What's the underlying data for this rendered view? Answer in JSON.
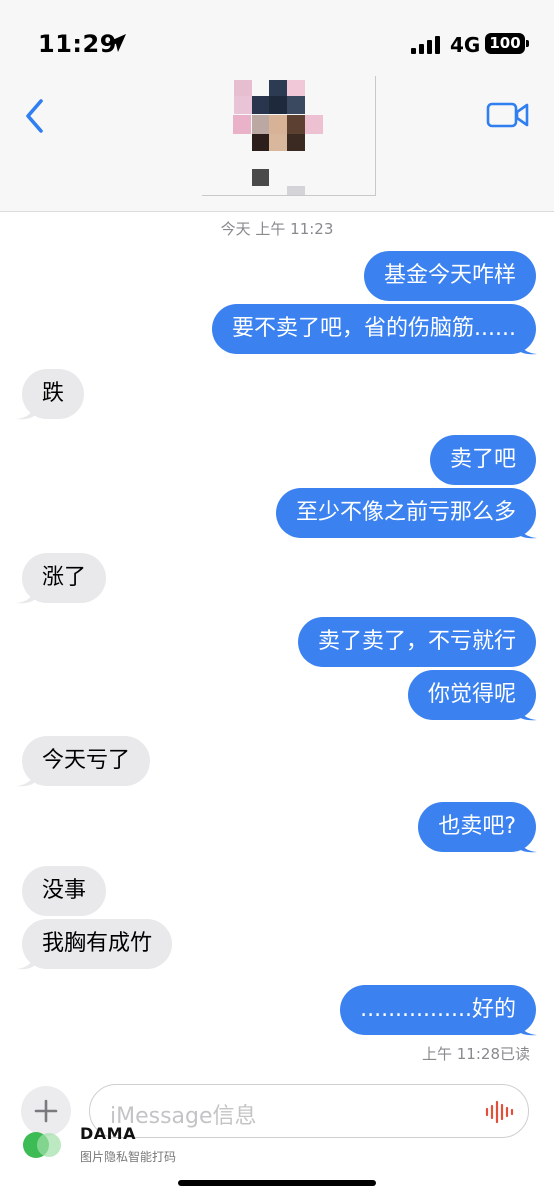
{
  "status_bar": {
    "time": "11:29",
    "network": "4G",
    "battery": "100"
  },
  "chat": {
    "timestamp": "今天 上午 11:23",
    "read_receipt": "上午 11:28已读",
    "messages": [
      {
        "side": "sent",
        "text": "基金今天咋样"
      },
      {
        "side": "sent",
        "text": "要不卖了吧，省的伤脑筋......"
      },
      {
        "side": "received",
        "text": "跌"
      },
      {
        "side": "sent",
        "text": "卖了吧"
      },
      {
        "side": "sent",
        "text": "至少不像之前亏那么多"
      },
      {
        "side": "received",
        "text": "涨了"
      },
      {
        "side": "sent",
        "text": "卖了卖了，不亏就行"
      },
      {
        "side": "sent",
        "text": "你觉得呢"
      },
      {
        "side": "received",
        "text": "今天亏了"
      },
      {
        "side": "sent",
        "text": "也卖吧?"
      },
      {
        "side": "received",
        "text": "没事"
      },
      {
        "side": "received",
        "text": "我胸有成竹"
      },
      {
        "side": "sent",
        "text": "................好的"
      }
    ]
  },
  "input": {
    "placeholder": "iMessage信息"
  },
  "watermark": {
    "title": "DAMA",
    "subtitle": "图片隐私智能打码"
  },
  "colors": {
    "sent_bubble": "#3b82f0",
    "received_bubble": "#e9e9eb",
    "accent": "#2f7ff0"
  },
  "icons": {
    "back": "chevron-left-icon",
    "video": "video-camera-icon",
    "location": "location-arrow-icon",
    "signal": "cellular-signal-icon",
    "add": "plus-icon",
    "mic": "audio-waveform-icon"
  }
}
